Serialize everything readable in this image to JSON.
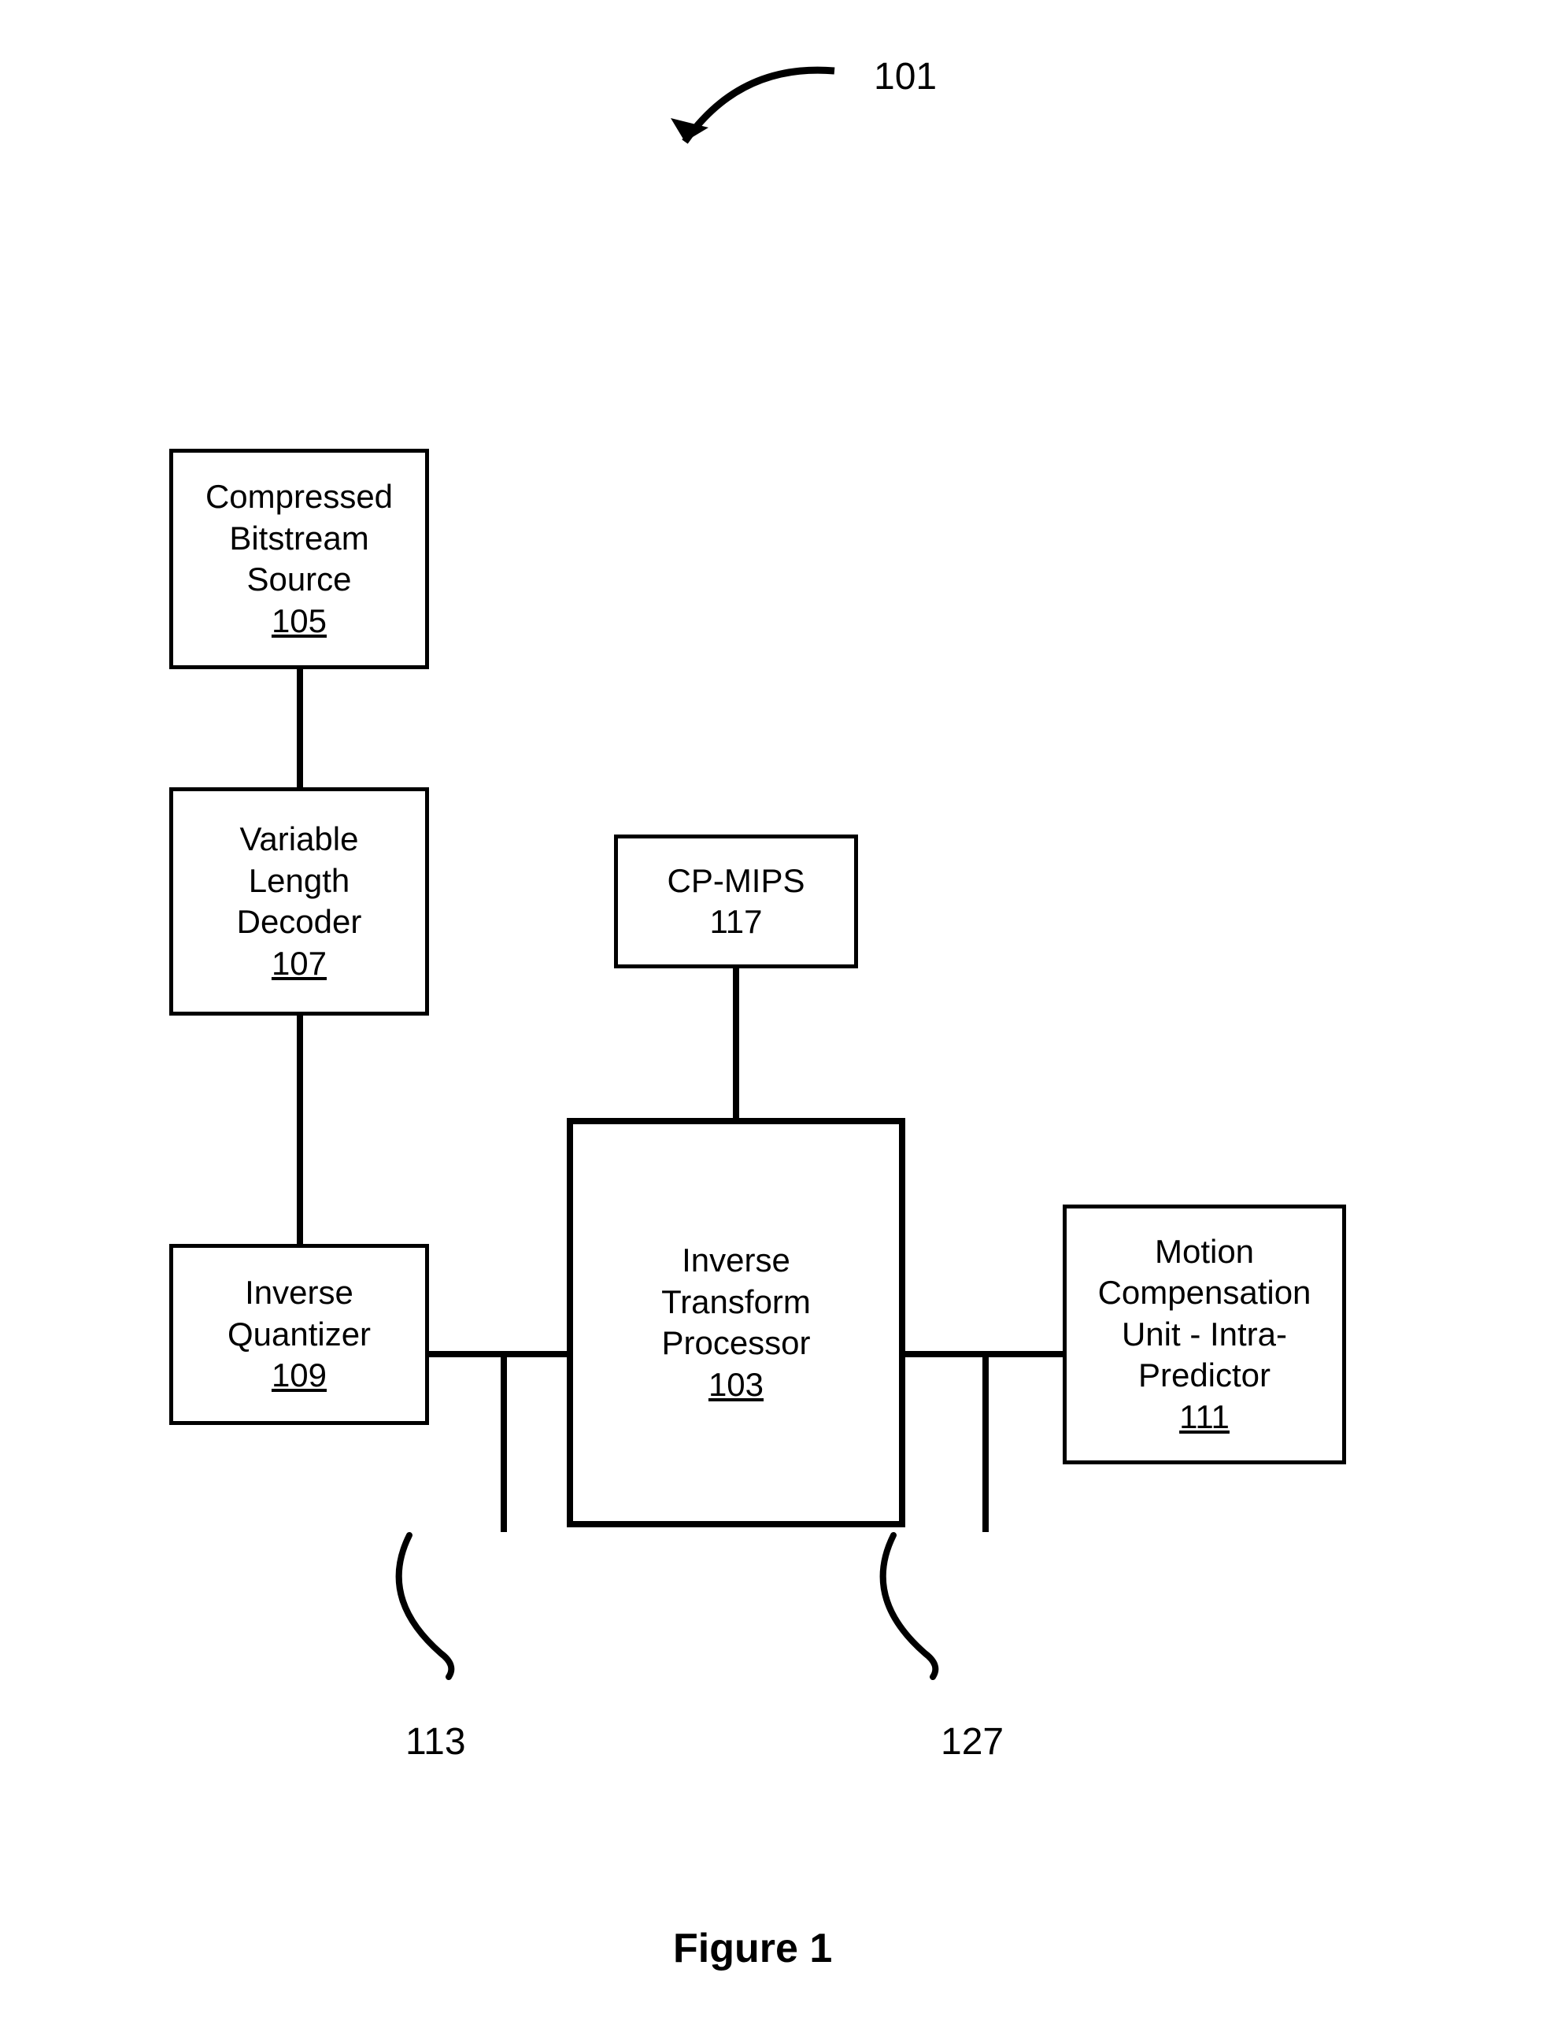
{
  "figure_label": "101",
  "caption": "Figure 1",
  "boxes": {
    "source": {
      "line1": "Compressed",
      "line2": "Bitstream",
      "line3": "Source",
      "ref": "105"
    },
    "decoder": {
      "line1": "Variable",
      "line2": "Length",
      "line3": "Decoder",
      "ref": "107"
    },
    "cpmips": {
      "line1": "CP-MIPS",
      "ref": "117"
    },
    "quant": {
      "line1": "Inverse",
      "line2": "Quantizer",
      "ref": "109"
    },
    "itp": {
      "line1": "Inverse",
      "line2": "Transform",
      "line3": "Processor",
      "ref": "103"
    },
    "motion": {
      "line1": "Motion",
      "line2": "Compensation",
      "line3": "Unit - Intra-",
      "line4": "Predictor",
      "ref": "111"
    }
  },
  "pointers": {
    "left": "113",
    "right": "127"
  }
}
